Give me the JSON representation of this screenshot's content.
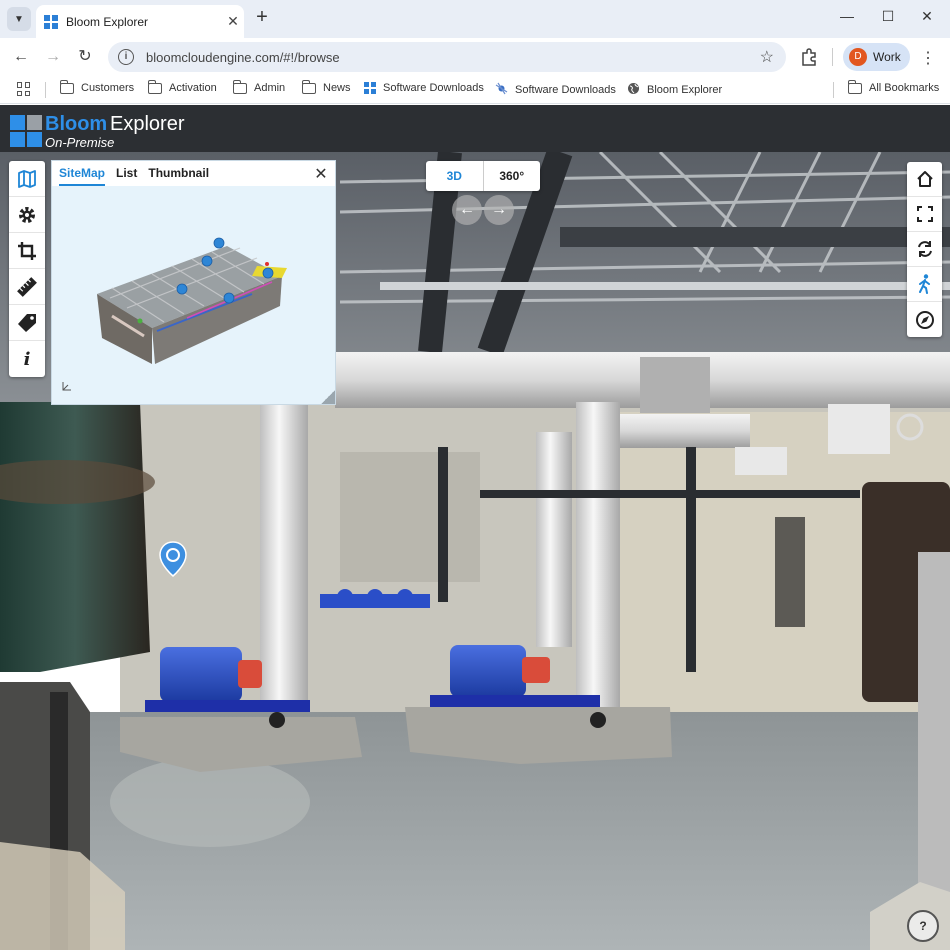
{
  "browser": {
    "tab_title": "Bloom Explorer",
    "url": "bloomcloudengine.com/#!/browse",
    "profile_initial": "D",
    "profile_label": "Work",
    "bookmarks": [
      {
        "label": "Customers",
        "icon": "folder-icon"
      },
      {
        "label": "Activation",
        "icon": "folder-icon"
      },
      {
        "label": "Admin",
        "icon": "folder-icon"
      },
      {
        "label": "News",
        "icon": "folder-icon"
      },
      {
        "label": "Software Downloads",
        "icon": "windows-logo-icon"
      },
      {
        "label": "Software Downloads",
        "icon": "satellite-icon"
      },
      {
        "label": "Bloom Explorer",
        "icon": "globe-icon"
      }
    ],
    "all_bookmarks": "All Bookmarks"
  },
  "app": {
    "brand_primary": "Bloom",
    "brand_secondary": "Explorer",
    "edition": "On-Premise",
    "accent_color": "#1f86d6"
  },
  "sitemap": {
    "tabs": [
      "SiteMap",
      "List",
      "Thumbnail"
    ],
    "active_tab": "SiteMap"
  },
  "view_toggle": {
    "options": [
      "3D",
      "360°"
    ],
    "active": "3D"
  },
  "left_tools": [
    "map-icon",
    "gear-icon",
    "crop-icon",
    "ruler-icon",
    "tag-icon",
    "info-icon"
  ],
  "right_tools": [
    "home-icon",
    "fullscreen-icon",
    "rotate-icon",
    "walk-icon",
    "compass-icon"
  ],
  "help_label": "?"
}
